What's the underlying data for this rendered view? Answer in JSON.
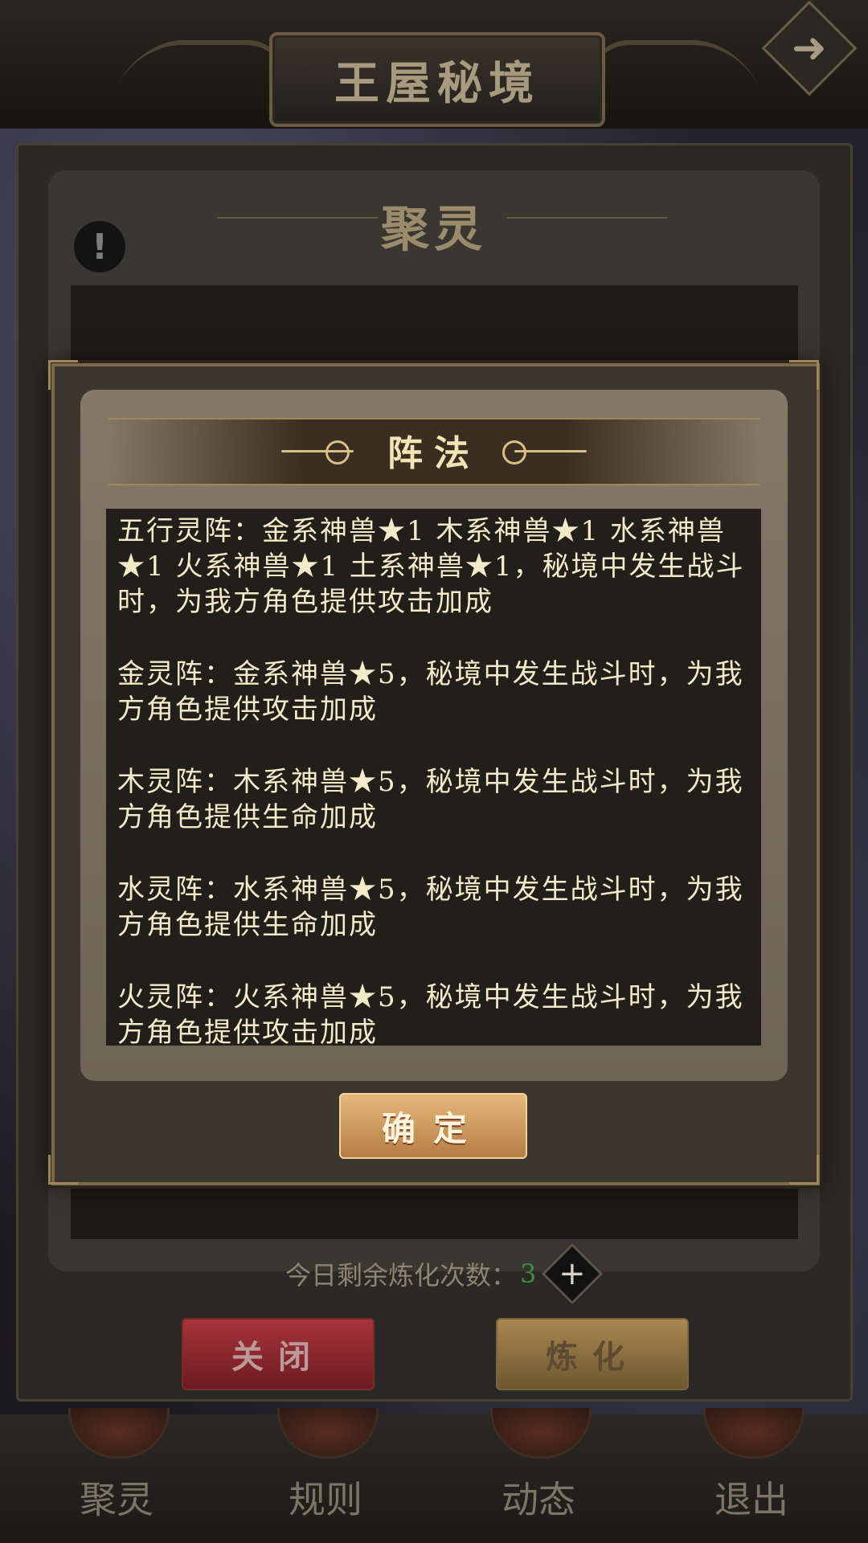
{
  "header": {
    "title": "王屋秘境",
    "exit_icon": "arrow-right-icon"
  },
  "panel": {
    "title": "聚灵",
    "info_icon": "exclamation-icon",
    "remaining_label": "今日剩余炼化次数：",
    "remaining_count": "3",
    "close_label": "关闭",
    "refine_label": "炼化"
  },
  "nav": {
    "items": [
      {
        "label": "聚灵"
      },
      {
        "label": "规则"
      },
      {
        "label": "动态"
      },
      {
        "label": "退出"
      }
    ]
  },
  "modal": {
    "title": "阵法",
    "ok_label": "确定",
    "paragraphs": [
      "五行灵阵：金系神兽★1 木系神兽★1 水系神兽★1 火系神兽★1 土系神兽★1，秘境中发生战斗时，为我方角色提供攻击加成",
      "金灵阵：金系神兽★5，秘境中发生战斗时，为我方角色提供攻击加成",
      "木灵阵：木系神兽★5，秘境中发生战斗时，为我方角色提供生命加成",
      "水灵阵：水系神兽★5，秘境中发生战斗时，为我方角色提供生命加成",
      "火灵阵：火系神兽★5，秘境中发生战斗时，为我方角色提供攻击加成"
    ]
  }
}
